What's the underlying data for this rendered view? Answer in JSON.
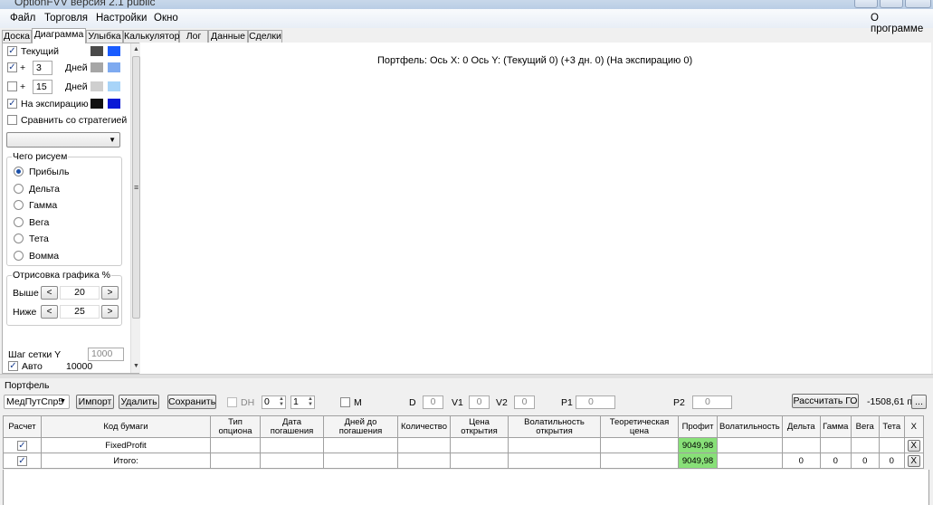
{
  "window": {
    "title": "OptionFVV версия 2.1 public"
  },
  "menu": {
    "items": [
      "Файл",
      "Торговля",
      "Настройки",
      "Окно"
    ],
    "about": "О программе"
  },
  "tabs": [
    "Доска",
    "Диаграмма",
    "Улыбка",
    "Калькулятор",
    "Лог",
    "Данные",
    "Сделки"
  ],
  "left": {
    "current_label": "Текущий",
    "plus": "+",
    "days_label": "Дней",
    "days1": "3",
    "days2": "15",
    "expiry_label": "На экспирацию",
    "compare_label": "Сравнить со стратегией",
    "draw_group": "Чего рисуем",
    "radios": [
      "Прибыль",
      "Дельта",
      "Гамма",
      "Вега",
      "Тета",
      "Вомма"
    ],
    "plot_group": "Отрисовка графика %",
    "above_label": "Выше",
    "below_label": "Ниже",
    "above_value": "20",
    "below_value": "25",
    "prev": "<",
    "next": ">",
    "grid_label": "Шаг сетки Y",
    "grid_value": "1000",
    "auto_label": "Авто",
    "auto_value": "10000",
    "colors": {
      "current_dark": "#4a4a4a",
      "current_blue": "#1a5cff",
      "plus1_gray": "#a6a6a6",
      "plus1_blue": "#7eaaf0",
      "plus2_gray": "#cfcfcf",
      "plus2_blue": "#a8d4f8",
      "expiry_dark": "#111111",
      "expiry_blue": "#0b1ad6"
    }
  },
  "chart": {
    "title": "Портфель: Ось X: 0 Ось Y:  (Текущий 0)  (+3 дн. 0)  (На экспирацию 0)"
  },
  "portfolio": {
    "label": "Портфель",
    "combo_value": "МедПутСпр5",
    "import_btn": "Импорт",
    "delete_btn": "Удалить",
    "save_btn": "Сохранить",
    "dh_label": "DH",
    "dh_value": "0",
    "dh_value2": "1",
    "m_label": "M",
    "d_label": "D",
    "d_value": "0",
    "v1_label": "V1",
    "v1_value": "0",
    "v2_label": "V2",
    "v2_value": "0",
    "p1_label": "P1",
    "p1_value": "0",
    "p2_label": "P2",
    "p2_value": "0",
    "calc_btn": "Рассчитать ГО",
    "go_value": "-1508,61 п.",
    "more_btn": "..."
  },
  "table": {
    "headers": [
      "Расчет",
      "Код бумаги",
      "Тип опциона",
      "Дата погашения",
      "Дней до погашения",
      "Количество",
      "Цена открытия",
      "Волатильность открытия",
      "Теоретическая цена",
      "Профит",
      "Волатильность",
      "Дельта",
      "Гамма",
      "Вега",
      "Тета",
      "X"
    ],
    "rows": [
      {
        "checked": true,
        "code": "FixedProfit",
        "profit": "9049,98",
        "delta": "",
        "gamma": "",
        "vega": "",
        "theta": "",
        "x": "X"
      },
      {
        "checked": true,
        "code": "Итого:",
        "profit": "9049,98",
        "delta": "0",
        "gamma": "0",
        "vega": "0",
        "theta": "0",
        "x": "X"
      }
    ]
  }
}
